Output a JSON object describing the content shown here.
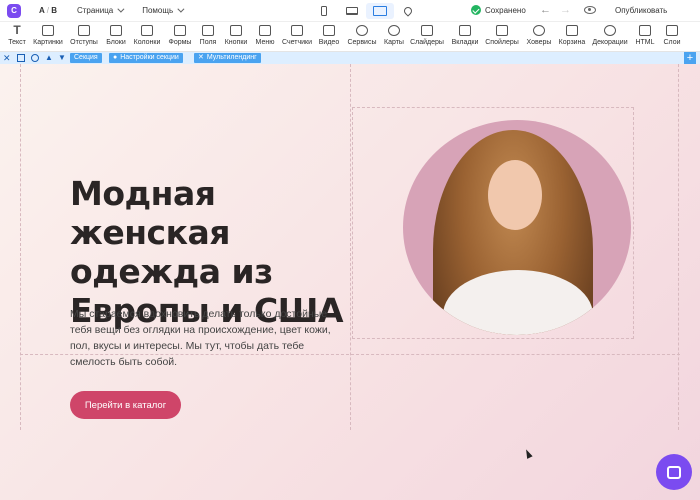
{
  "topbar": {
    "ab_a": "A",
    "ab_sep": "/",
    "ab_b": "B",
    "page_menu": "Страница",
    "help_menu": "Помощь",
    "saved_status": "Сохранено",
    "publish": "Опубликовать"
  },
  "toolbar": {
    "items": [
      {
        "label": "Текст",
        "icon": "text-icon"
      },
      {
        "label": "Картинки",
        "icon": "image-icon"
      },
      {
        "label": "Отступы",
        "icon": "spacing-icon"
      },
      {
        "label": "Блоки",
        "icon": "blocks-icon"
      },
      {
        "label": "Колонки",
        "icon": "columns-icon"
      },
      {
        "label": "Формы",
        "icon": "forms-icon"
      },
      {
        "label": "Поля",
        "icon": "fields-icon"
      },
      {
        "label": "Кнопки",
        "icon": "buttons-icon"
      },
      {
        "label": "Меню",
        "icon": "menu-icon"
      },
      {
        "label": "Счетчики",
        "icon": "counters-icon"
      },
      {
        "label": "Видео",
        "icon": "video-icon"
      },
      {
        "label": "Сервисы",
        "icon": "services-icon"
      },
      {
        "label": "Карты",
        "icon": "map-icon"
      },
      {
        "label": "Слайдеры",
        "icon": "sliders-icon"
      },
      {
        "label": "Вкладки",
        "icon": "tabs-icon"
      },
      {
        "label": "Спойлеры",
        "icon": "spoilers-icon"
      },
      {
        "label": "Ховеры",
        "icon": "hovers-icon"
      },
      {
        "label": "Корзина",
        "icon": "cart-icon"
      },
      {
        "label": "Декорации",
        "icon": "decorations-icon"
      },
      {
        "label": "HTML",
        "icon": "html-icon"
      },
      {
        "label": "Слои",
        "icon": "layers-icon"
      }
    ]
  },
  "section_bar": {
    "section": "Секция",
    "section_settings": "Настройки секции",
    "multilanding": "Мультилендинг"
  },
  "hero": {
    "heading": "Модная женская одежда из Европы и США",
    "description": "Мы стараемся вдохновить делать только достойные тебя вещи без оглядки на происхождение, цвет кожи, пол, вкусы и интересы. Мы тут, чтобы дать тебе смелость быть собой.",
    "cta": "Перейти в каталог"
  },
  "colors": {
    "accent": "#7b4bf0",
    "cta": "#cf4569",
    "selection": "#4aa3f0"
  }
}
